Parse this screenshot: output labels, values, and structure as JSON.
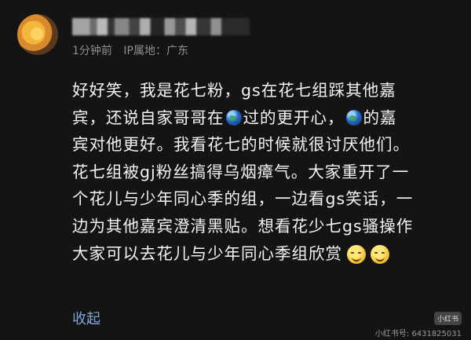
{
  "author": {
    "meta": {
      "time": "1分钟前",
      "ip_location": "IP属地：广东"
    }
  },
  "comment": {
    "line1": "好好笑，我是花七粉，gs在花七组踩其他嘉",
    "line2": "宾，还说自家哥哥在",
    "line2_after_globe1": "过的更开心，",
    "line2_after_globe2": "的嘉",
    "line3": "宾对他更好。我看花七的时候就很讨厌他们。",
    "line4": "花七组被gj粉丝搞得乌烟瘴气。大家重开了一",
    "line5": "个花儿与少年同心季的组，一边看gs笑话，一",
    "line6": "边为其他嘉宾澄清黑贴。想看花少七gs骚操作",
    "line7": "大家可以去花儿与少年同心季组欣赏"
  },
  "actions": {
    "collapse": "收起"
  },
  "watermark": {
    "logo": "小红书",
    "id": "小红书号: 6431825031"
  },
  "icons": [
    "avatar",
    "globe-emoji-icon",
    "laughing-face-emoji-icon"
  ]
}
